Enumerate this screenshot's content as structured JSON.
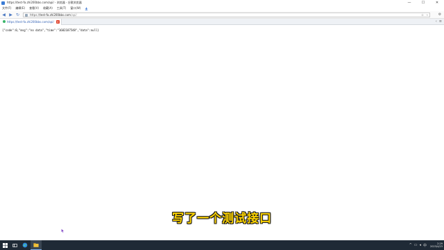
{
  "window": {
    "title": "https://test-fa.zhi200bbs.com/api/ - 浏览器 - 谷歌浏览器",
    "controls": {
      "minimize": "—",
      "maximize": "☐",
      "close": "✕"
    }
  },
  "menu": [
    "文件(F)",
    "编辑(E)",
    "查看(V)",
    "收藏(A)",
    "工具(T)",
    "窗口(W)"
  ],
  "address": {
    "scheme": "https://",
    "host": "test-fa.zhi200bbs.com",
    "path": "/api/"
  },
  "tab": {
    "label": "https://test-fa.zhi200bbs.com/api/",
    "close": "×"
  },
  "content": {
    "json_text": "{\"code\":0,\"msg\":\"no data\",\"time\":\"1682187548\",\"data\":null}"
  },
  "subtitle": "写了一个测试接口",
  "taskbar": {
    "time": "2:29",
    "date": "2023/4/23"
  },
  "colors": {
    "subtitle_fill": "#ffd400",
    "taskbar_bg": "#1f2a36",
    "tab_close": "#e0442e"
  }
}
